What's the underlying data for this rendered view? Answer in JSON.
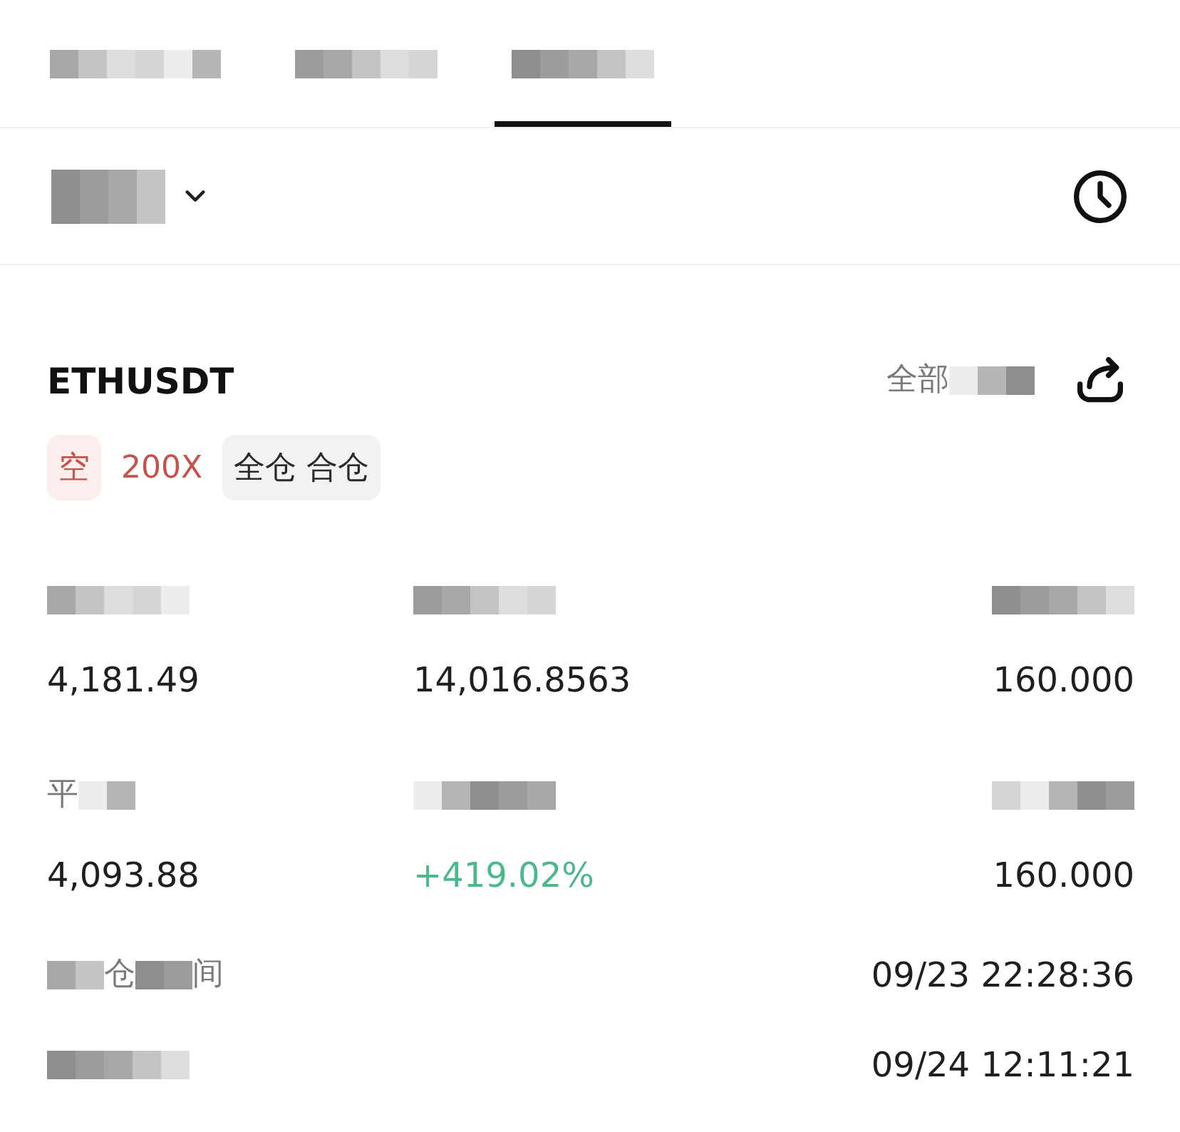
{
  "tabs": [
    {
      "label": [
        {
          "kind": "mosaic"
        }
      ],
      "selected": false
    },
    {
      "label": [
        {
          "kind": "mosaic"
        }
      ],
      "selected": false
    },
    {
      "label": [
        {
          "kind": "mosaic"
        }
      ],
      "selected": true
    }
  ],
  "filter": {
    "label": [
      {
        "kind": "mosaic"
      }
    ]
  },
  "position": {
    "symbol": "ETHUSDT",
    "action": [
      {
        "kind": "text",
        "text": "全部"
      },
      {
        "kind": "mosaic"
      }
    ],
    "tags": [
      {
        "kind": "side",
        "text": "空"
      },
      {
        "kind": "leverage",
        "text": "200X"
      },
      {
        "kind": "mode",
        "text": "全仓 合仓"
      }
    ],
    "stats": [
      {
        "label": [
          {
            "kind": "mosaic"
          }
        ],
        "value": "4,181.49",
        "kind": "plain"
      },
      {
        "label": [
          {
            "kind": "mosaic"
          }
        ],
        "value": "14,016.8563",
        "kind": "plain"
      },
      {
        "label": [
          {
            "kind": "mosaic"
          }
        ],
        "value": "160.000",
        "kind": "plain"
      },
      {
        "label": [
          {
            "kind": "text",
            "text": "平"
          },
          {
            "kind": "mosaic"
          }
        ],
        "value": "4,093.88",
        "kind": "plain"
      },
      {
        "label": [
          {
            "kind": "mosaic"
          }
        ],
        "value": "+419.02%",
        "kind": "gain"
      },
      {
        "label": [
          {
            "kind": "mosaic"
          }
        ],
        "value": "160.000",
        "kind": "plain"
      }
    ],
    "times": [
      {
        "label": [
          {
            "kind": "mosaic"
          },
          {
            "kind": "text",
            "text": "仓"
          },
          {
            "kind": "mosaic"
          },
          {
            "kind": "text",
            "text": "间"
          }
        ],
        "value": "09/23 22:28:36"
      },
      {
        "label": [
          {
            "kind": "mosaic"
          }
        ],
        "value": "09/24 12:11:21"
      }
    ]
  }
}
